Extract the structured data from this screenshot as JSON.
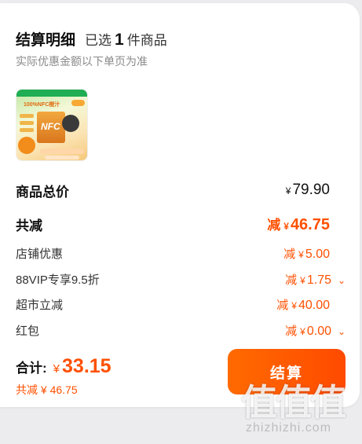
{
  "header": {
    "title": "结算明细",
    "selected_prefix": "已选",
    "selected_count": "1",
    "selected_suffix": "件商品",
    "subtitle": "实际优惠金额以下单页为准"
  },
  "product": {
    "image_text": "100%NFC橙汁",
    "box_text": "NFC"
  },
  "rows": {
    "subtotal": {
      "label": "商品总价",
      "currency": "¥",
      "amount": "79.90"
    },
    "total_discount": {
      "label": "共减",
      "prefix": "减",
      "currency": "¥",
      "amount": "46.75"
    },
    "shop": {
      "label": "店铺优惠",
      "prefix": "减",
      "currency": "¥",
      "amount": "5.00"
    },
    "vip": {
      "label": "88VIP专享9.5折",
      "prefix": "减",
      "currency": "¥",
      "amount": "1.75"
    },
    "market": {
      "label": "超市立减",
      "prefix": "减",
      "currency": "¥",
      "amount": "40.00"
    },
    "redpacket": {
      "label": "红包",
      "prefix": "减",
      "currency": "¥",
      "amount": "0.00"
    }
  },
  "footer": {
    "total_label": "合计:",
    "currency": "¥",
    "total_amount": "33.15",
    "saved_text": "共减 ¥ 46.75",
    "checkout_label": "结算"
  },
  "watermark": {
    "glyphs": "值值值",
    "url": "zhizhizhi.com"
  },
  "colors": {
    "accent": "#ff5000",
    "background": "#ececef",
    "card": "#ffffff"
  },
  "icons": {
    "chevron": "chevron-down-icon"
  }
}
